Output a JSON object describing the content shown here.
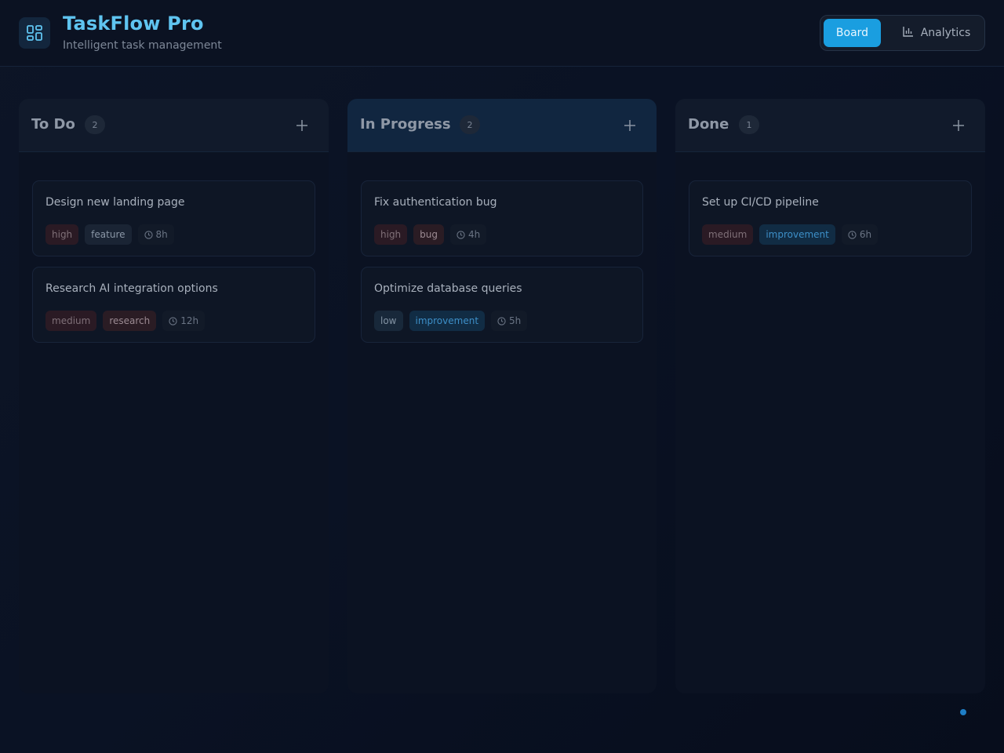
{
  "header": {
    "title": "TaskFlow Pro",
    "subtitle": "Intelligent task management",
    "logo_icon": "grid-layout-icon",
    "views": [
      {
        "label": "Board",
        "active": true
      },
      {
        "label": "Analytics",
        "active": false,
        "icon": "bar-chart-icon"
      }
    ]
  },
  "columns": [
    {
      "title": "To Do",
      "count": "2",
      "cards": [
        {
          "title": "Design new landing page",
          "priority": "high",
          "category": "feature",
          "estimate": "8h"
        },
        {
          "title": "Research AI integration options",
          "priority": "medium",
          "category": "research",
          "estimate": "12h"
        }
      ]
    },
    {
      "title": "In Progress",
      "count": "2",
      "cards": [
        {
          "title": "Fix authentication bug",
          "priority": "high",
          "category": "bug",
          "estimate": "4h"
        },
        {
          "title": "Optimize database queries",
          "priority": "low",
          "category": "improvement",
          "estimate": "5h"
        }
      ]
    },
    {
      "title": "Done",
      "count": "1",
      "cards": [
        {
          "title": "Set up CI/CD pipeline",
          "priority": "medium",
          "category": "improvement",
          "estimate": "6h"
        }
      ]
    }
  ],
  "colors": {
    "accent": "#1a9ee0",
    "title": "#5fc4f0",
    "improvement": "#3d8fc8"
  }
}
